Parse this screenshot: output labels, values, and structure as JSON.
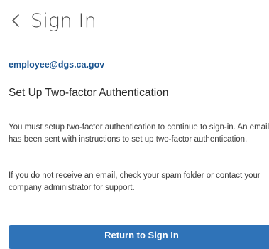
{
  "header": {
    "title": "Sign In",
    "back_icon": "chevron-left-icon"
  },
  "account": {
    "email": "employee@dgs.ca.gov"
  },
  "main": {
    "section_title": "Set Up Two-factor Authentication",
    "paragraph_1": "You must setup two-factor authentication to continue to sign-in. An email has been sent with instructions to set up two-factor authentication.",
    "paragraph_2": "If you do not receive an email, check your spam folder or contact your company administrator for support."
  },
  "actions": {
    "return_label": "Return to Sign In"
  },
  "colors": {
    "link_blue": "#1a5490",
    "button_blue": "#2f73b8",
    "text": "#3a3a3a"
  }
}
